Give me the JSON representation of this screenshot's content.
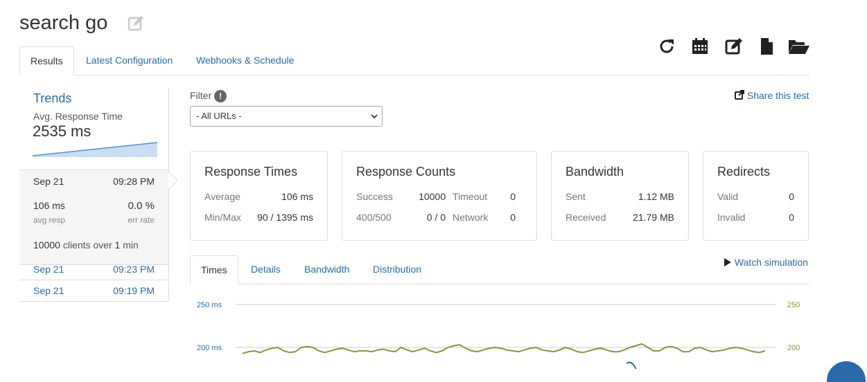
{
  "header": {
    "title": "search go"
  },
  "tabs": [
    {
      "label": "Results",
      "active": true
    },
    {
      "label": "Latest Configuration",
      "active": false
    },
    {
      "label": "Webhooks & Schedule",
      "active": false
    }
  ],
  "toolbar": {
    "icons": [
      "refresh-icon",
      "calendar-icon",
      "edit-icon",
      "file-icon",
      "folder-open-icon"
    ]
  },
  "sidebar": {
    "trends_title": "Trends",
    "avg_label": "Avg. Response Time",
    "avg_value": "2535 ms",
    "active_run": {
      "date": "Sep 21",
      "time": "09:28 PM",
      "avg_resp": "106 ms",
      "avg_resp_label": "avg resp",
      "err_rate": "0.0 %",
      "err_rate_label": "err rate",
      "clients": "10000",
      "clients_mid": "clients over",
      "duration": "1",
      "duration_unit": "min"
    },
    "runs": [
      {
        "date": "Sep 21",
        "time": "09:23 PM"
      },
      {
        "date": "Sep 21",
        "time": "09:19 PM"
      }
    ]
  },
  "filter": {
    "label": "Filter",
    "info": "!",
    "selected": "- All URLs -"
  },
  "share_label": "Share this test",
  "cards": {
    "response_times": {
      "title": "Response Times",
      "average_label": "Average",
      "average_value": "106 ms",
      "minmax_label": "Min/Max",
      "minmax_value": "90 / 1395 ms"
    },
    "response_counts": {
      "title": "Response Counts",
      "success_label": "Success",
      "success_value": "10000",
      "timeout_label": "Timeout",
      "timeout_value": "0",
      "err_label": "400/500",
      "err_value": "0 / 0",
      "network_label": "Network",
      "network_value": "0"
    },
    "bandwidth": {
      "title": "Bandwidth",
      "sent_label": "Sent",
      "sent_value": "1.12 MB",
      "received_label": "Received",
      "received_value": "21.79 MB"
    },
    "redirects": {
      "title": "Redirects",
      "valid_label": "Valid",
      "valid_value": "0",
      "invalid_label": "Invalid",
      "invalid_value": "0"
    }
  },
  "chart_tabs": [
    {
      "label": "Times",
      "active": true
    },
    {
      "label": "Details",
      "active": false
    },
    {
      "label": "Bandwidth",
      "active": false
    },
    {
      "label": "Distribution",
      "active": false
    }
  ],
  "watch_simulation": "Watch simulation",
  "colors": {
    "link": "#2a6aa8",
    "response_line": "#7a9a3c",
    "clients_line": "#2a6aa8"
  },
  "chart_data": {
    "type": "line",
    "left_ticks": [
      "250 ms",
      "200 ms"
    ],
    "right_ticks": [
      "250",
      "200"
    ],
    "left_ylim_visible": [
      190,
      250
    ],
    "series": [
      {
        "values": [
          193,
          195,
          196,
          194,
          197,
          199,
          200,
          196,
          194,
          195,
          200,
          201,
          200,
          196,
          194,
          196,
          198,
          199,
          197,
          195,
          196,
          196,
          195,
          197,
          198,
          196,
          195,
          200,
          197,
          195,
          197,
          199,
          196,
          194,
          196,
          200,
          202,
          203,
          199,
          196,
          195,
          197,
          199,
          200,
          199,
          197,
          196,
          195,
          197,
          199,
          200,
          197,
          196,
          195,
          197,
          200,
          198,
          195,
          194,
          196,
          198,
          199,
          197,
          195,
          195,
          197,
          200,
          202,
          204,
          200,
          196,
          196,
          200,
          201,
          199,
          195,
          195,
          199,
          200,
          197,
          195,
          196,
          197,
          199,
          200,
          199,
          197,
          195,
          194,
          196
        ]
      }
    ]
  }
}
